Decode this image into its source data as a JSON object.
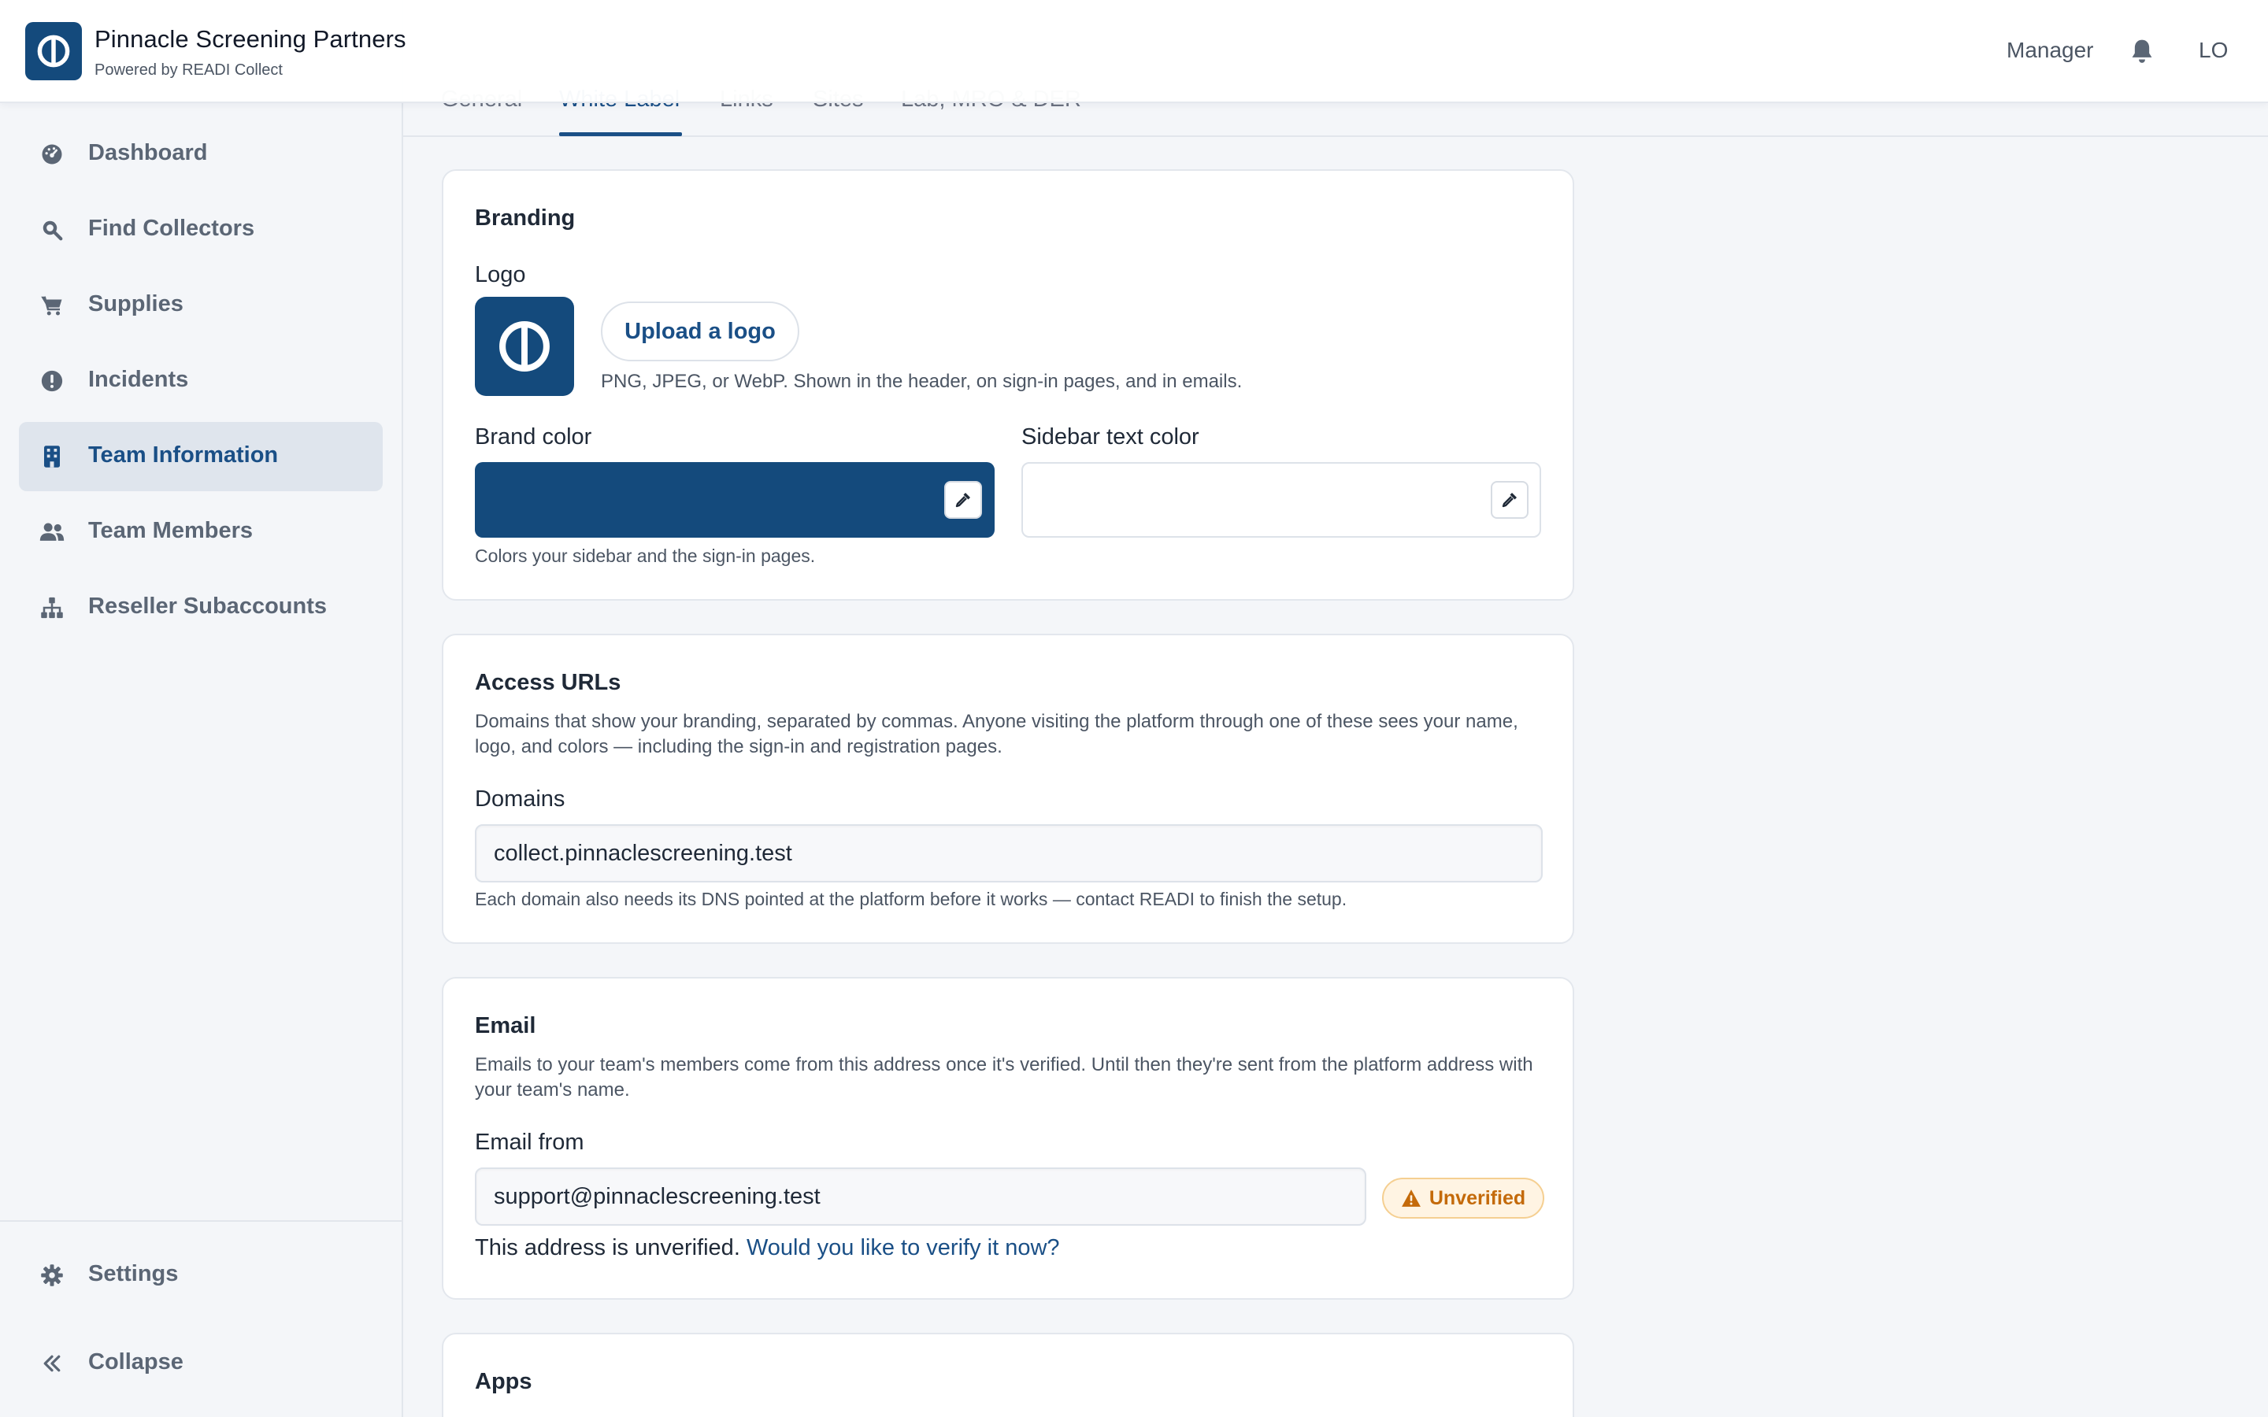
{
  "header": {
    "org_name": "Pinnacle Screening Partners",
    "powered_by": "Powered by READI Collect",
    "role": "Manager",
    "user_initials": "LO",
    "brand_color": "#144a7c"
  },
  "sidebar": {
    "items": [
      {
        "label": "Dashboard",
        "icon": "dashboard-gauge-icon"
      },
      {
        "label": "Find Collectors",
        "icon": "search-icon"
      },
      {
        "label": "Supplies",
        "icon": "cart-icon"
      },
      {
        "label": "Incidents",
        "icon": "alert-circle-icon"
      },
      {
        "label": "Team Information",
        "icon": "building-icon",
        "active": true
      },
      {
        "label": "Team Members",
        "icon": "users-icon"
      },
      {
        "label": "Reseller Subaccounts",
        "icon": "hierarchy-icon"
      }
    ],
    "settings_label": "Settings",
    "collapse_label": "Collapse"
  },
  "tabs": [
    "General",
    "White Label",
    "Links",
    "Sites",
    "Lab, MRO & DER"
  ],
  "active_tab": "White Label",
  "branding": {
    "title": "Branding",
    "logo_label": "Logo",
    "upload_label": "Upload a logo",
    "upload_hint": "PNG, JPEG, or WebP. Shown in the header, on sign-in pages, and in emails.",
    "brand_color_label": "Brand color",
    "brand_color_value": "#144a7c",
    "sidebar_text_color_label": "Sidebar text color",
    "sidebar_text_color_value": "#ffffff",
    "color_hint": "Colors your sidebar and the sign-in pages."
  },
  "access_urls": {
    "title": "Access URLs",
    "description": "Domains that show your branding, separated by commas. Anyone visiting the platform through one of these sees your name, logo, and colors — including the sign-in and registration pages.",
    "domains_label": "Domains",
    "domains_value": "collect.pinnaclescreening.test",
    "hint": "Each domain also needs its DNS pointed at the platform before it works — contact READI to finish the setup."
  },
  "email": {
    "title": "Email",
    "description": "Emails to your team's members come from this address once it's verified. Until then they're sent from the platform address with your team's name.",
    "from_label": "Email from",
    "from_value": "support@pinnaclescreening.test",
    "status_badge": "Unverified",
    "unverified_text": "This address is unverified.",
    "verify_link": "Would you like to verify it now?"
  },
  "apps": {
    "title": "Apps"
  }
}
